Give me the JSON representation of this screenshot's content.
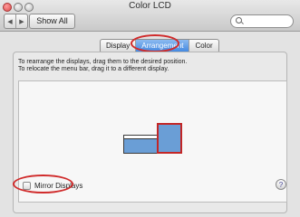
{
  "window": {
    "title": "Color LCD"
  },
  "toolbar": {
    "back_icon": "back-arrow-icon",
    "forward_icon": "forward-arrow-icon",
    "show_all_label": "Show All",
    "search_icon": "magnifier-icon",
    "search_placeholder": ""
  },
  "tabs": [
    {
      "label": "Display",
      "selected": false
    },
    {
      "label": "Arrangement",
      "selected": true
    },
    {
      "label": "Color",
      "selected": false
    }
  ],
  "instructions": {
    "line1": "To rearrange the displays, drag them to the desired position.",
    "line2": "To relocate the menu bar, drag it to a different display."
  },
  "mirror": {
    "label": "Mirror Displays",
    "checked": false
  },
  "help": {
    "label": "?"
  },
  "colors": {
    "accent": "#3f86e0",
    "highlight_circle": "#d02b2b",
    "display_fill": "#6a9ed6"
  }
}
